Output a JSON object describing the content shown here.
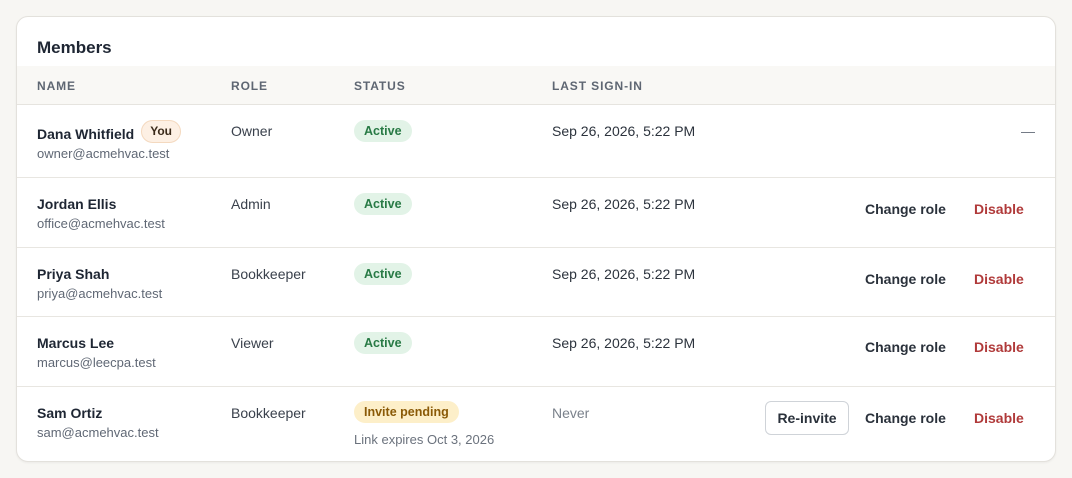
{
  "card": {
    "title": "Members"
  },
  "columns": {
    "name": "NAME",
    "role": "ROLE",
    "status": "STATUS",
    "last_sign_in": "LAST SIGN-IN"
  },
  "members": [
    {
      "name": "Dana Whitfield",
      "badge": "You",
      "email": "owner@acmehvac.test",
      "role": "Owner",
      "status": "Active",
      "last_sign_in": "Sep 26, 2026, 5:22 PM",
      "actions_placeholder": "—"
    },
    {
      "name": "Jordan Ellis",
      "email": "office@acmehvac.test",
      "role": "Admin",
      "status": "Active",
      "last_sign_in": "Sep 26, 2026, 5:22 PM",
      "change_role": "Change role",
      "disable": "Disable"
    },
    {
      "name": "Priya Shah",
      "email": "priya@acmehvac.test",
      "role": "Bookkeeper",
      "status": "Active",
      "last_sign_in": "Sep 26, 2026, 5:22 PM",
      "change_role": "Change role",
      "disable": "Disable"
    },
    {
      "name": "Marcus Lee",
      "email": "marcus@leecpa.test",
      "role": "Viewer",
      "status": "Active",
      "last_sign_in": "Sep 26, 2026, 5:22 PM",
      "change_role": "Change role",
      "disable": "Disable"
    },
    {
      "name": "Sam Ortiz",
      "email": "sam@acmehvac.test",
      "role": "Bookkeeper",
      "status": "Invite pending",
      "status_note": "Link expires Oct 3, 2026",
      "last_sign_in": "Never",
      "reinvite": "Re-invite",
      "change_role": "Change role",
      "disable": "Disable"
    }
  ],
  "colors": {
    "active_bg": "#e2f3e7",
    "active_text": "#287a45",
    "pending_bg": "#fdefc9",
    "pending_text": "#8a5a07",
    "danger": "#b03a3a"
  }
}
